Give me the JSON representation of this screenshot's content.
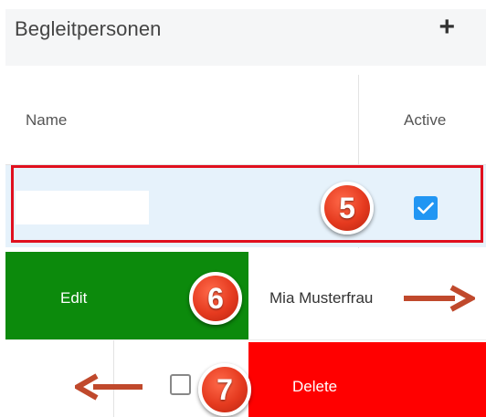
{
  "header": {
    "title": "Begleitpersonen",
    "add_icon": "plus-icon"
  },
  "table": {
    "columns": [
      "Name",
      "Active"
    ]
  },
  "rows": [
    {
      "name": "",
      "active": true
    },
    {
      "name": "Mia Musterfrau",
      "swipe_action": "Edit"
    },
    {
      "active": false,
      "swipe_action": "Delete"
    }
  ],
  "annotations": [
    "5",
    "6",
    "7"
  ],
  "colors": {
    "edit": "#0c8a0c",
    "delete": "#ff0000",
    "selected_row": "#e6f2fb",
    "highlight": "#e0101e",
    "arrow": "#c0492c",
    "checkbox": "#2196f3"
  },
  "icons": {
    "right_arrow": "arrow-right-icon",
    "left_arrow": "arrow-left-icon",
    "check": "check-icon"
  }
}
